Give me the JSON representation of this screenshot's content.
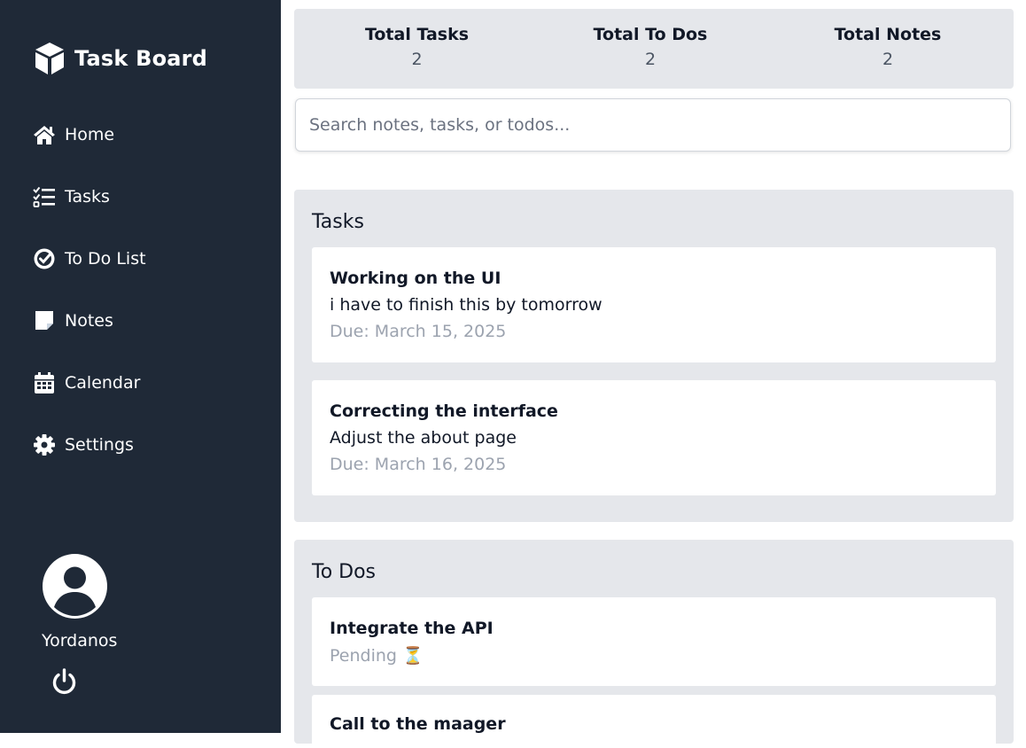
{
  "sidebar": {
    "brand": {
      "title": "Task Board",
      "icon": "cube-icon"
    },
    "items": [
      {
        "label": "Home",
        "icon": "home-icon"
      },
      {
        "label": "Tasks",
        "icon": "list-check-icon"
      },
      {
        "label": "To Do List",
        "icon": "circle-check-icon"
      },
      {
        "label": "Notes",
        "icon": "sticky-note-icon"
      },
      {
        "label": "Calendar",
        "icon": "calendar-icon"
      },
      {
        "label": "Settings",
        "icon": "gear-icon"
      }
    ],
    "user": {
      "name": "Yordanos",
      "avatar_icon": "user-circle-icon",
      "logout_icon": "power-icon"
    }
  },
  "stats": [
    {
      "label": "Total Tasks",
      "value": "2"
    },
    {
      "label": "Total To Dos",
      "value": "2"
    },
    {
      "label": "Total Notes",
      "value": "2"
    }
  ],
  "search": {
    "placeholder": "Search notes, tasks, or todos...",
    "value": ""
  },
  "tasks": {
    "title": "Tasks",
    "items": [
      {
        "title": "Working on the UI",
        "description": "i have to finish this by tomorrow",
        "due": "Due: March 15, 2025"
      },
      {
        "title": "Correcting the interface",
        "description": "Adjust the about page",
        "due": "Due: March 16, 2025"
      }
    ]
  },
  "todos": {
    "title": "To Dos",
    "items": [
      {
        "title": "Integrate the API",
        "status": "Pending ⏳"
      },
      {
        "title": "Call to the maager"
      }
    ]
  },
  "colors": {
    "sidebar_bg": "#1f2937",
    "panel_bg": "#e5e7eb",
    "muted_text": "#9ca3af"
  }
}
